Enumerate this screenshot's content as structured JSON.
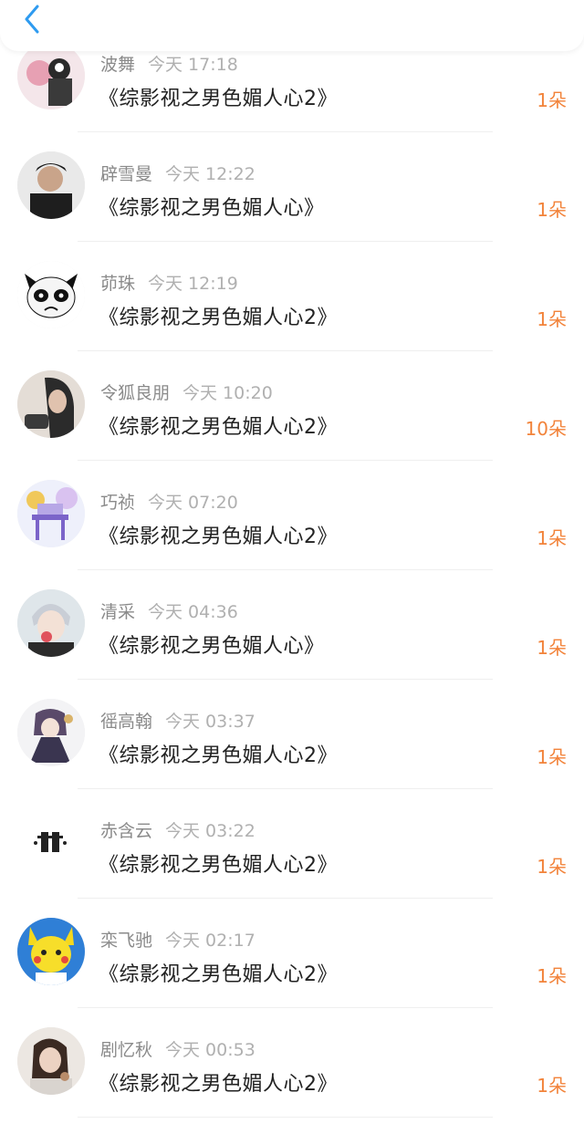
{
  "nav": {
    "back_icon": "chevron-left-icon",
    "accent": "#2e9bf0"
  },
  "count_color": "#f2833a",
  "items": [
    {
      "name": "波舞",
      "time": "今天 17:18",
      "title": "《综影视之男色媚人心2》",
      "count": "1朵"
    },
    {
      "name": "辟雪曼",
      "time": "今天 12:22",
      "title": "《综影视之男色媚人心》",
      "count": "1朵"
    },
    {
      "name": "茆珠",
      "time": "今天 12:19",
      "title": "《综影视之男色媚人心2》",
      "count": "1朵"
    },
    {
      "name": "令狐良朋",
      "time": "今天 10:20",
      "title": "《综影视之男色媚人心2》",
      "count": "10朵"
    },
    {
      "name": "巧祯",
      "time": "今天 07:20",
      "title": "《综影视之男色媚人心2》",
      "count": "1朵"
    },
    {
      "name": "清采",
      "time": "今天 04:36",
      "title": "《综影视之男色媚人心》",
      "count": "1朵"
    },
    {
      "name": "徭高翰",
      "time": "今天 03:37",
      "title": "《综影视之男色媚人心2》",
      "count": "1朵"
    },
    {
      "name": "赤含云",
      "time": "今天 03:22",
      "title": "《综影视之男色媚人心2》",
      "count": "1朵"
    },
    {
      "name": "栾飞驰",
      "time": "今天 02:17",
      "title": "《综影视之男色媚人心2》",
      "count": "1朵"
    },
    {
      "name": "剧忆秋",
      "time": "今天 00:53",
      "title": "《综影视之男色媚人心2》",
      "count": "1朵"
    }
  ]
}
